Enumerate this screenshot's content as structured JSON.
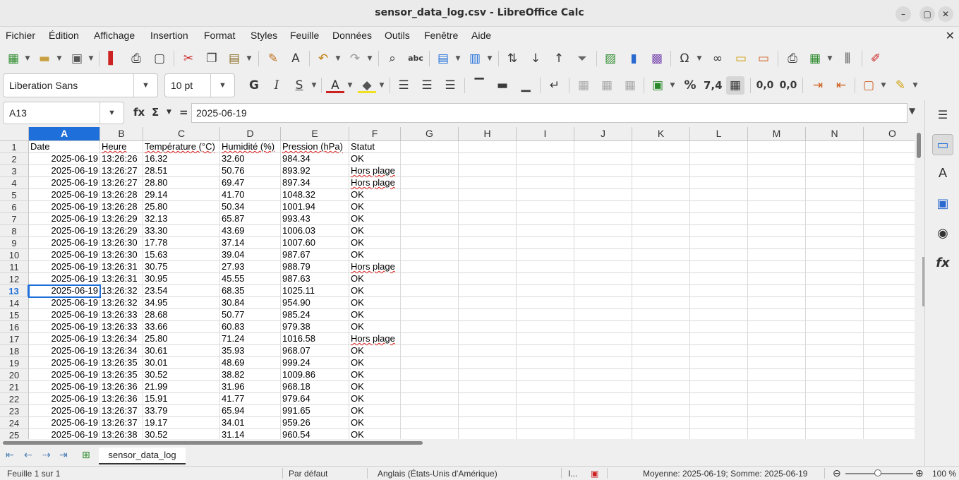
{
  "window": {
    "title": "sensor_data_log.csv - LibreOffice Calc",
    "minimize": "–",
    "maximize": "▢",
    "close": "✕"
  },
  "menu": [
    "Fichier",
    "Édition",
    "Affichage",
    "Insertion",
    "Format",
    "Styles",
    "Feuille",
    "Données",
    "Outils",
    "Fenêtre",
    "Aide"
  ],
  "menu_close": "✕",
  "toolbar2": {
    "font_name": "Liberation Sans",
    "font_size": "10 pt",
    "bold": "G",
    "italic": "I",
    "underline": "S",
    "percent": "%",
    "number": "7,4",
    "add_decimal": "0,0",
    "del_decimal": "0,0"
  },
  "formula": {
    "cell_ref": "A13",
    "fx": "fx",
    "sigma": "Σ",
    "equals": "=",
    "content": "2025-06-19"
  },
  "columns": [
    "A",
    "B",
    "C",
    "D",
    "E",
    "F",
    "G",
    "H",
    "I",
    "J",
    "K",
    "L",
    "M",
    "N",
    "O"
  ],
  "selected_column": "A",
  "selected_row": 13,
  "headers": [
    "Date",
    "Heure",
    "Température (°C)",
    "Humidité (%)",
    "Pression (hPa)",
    "Statut"
  ],
  "rows": [
    [
      "2025-06-19",
      "13:26:26",
      "16.32",
      "32.60",
      "984.34",
      "OK"
    ],
    [
      "2025-06-19",
      "13:26:27",
      "28.51",
      "50.76",
      "893.92",
      "Hors plage"
    ],
    [
      "2025-06-19",
      "13:26:27",
      "28.80",
      "69.47",
      "897.34",
      "Hors plage"
    ],
    [
      "2025-06-19",
      "13:26:28",
      "29.14",
      "41.70",
      "1048.32",
      "OK"
    ],
    [
      "2025-06-19",
      "13:26:28",
      "25.80",
      "50.34",
      "1001.94",
      "OK"
    ],
    [
      "2025-06-19",
      "13:26:29",
      "32.13",
      "65.87",
      "993.43",
      "OK"
    ],
    [
      "2025-06-19",
      "13:26:29",
      "33.30",
      "43.69",
      "1006.03",
      "OK"
    ],
    [
      "2025-06-19",
      "13:26:30",
      "17.78",
      "37.14",
      "1007.60",
      "OK"
    ],
    [
      "2025-06-19",
      "13:26:30",
      "15.63",
      "39.04",
      "987.67",
      "OK"
    ],
    [
      "2025-06-19",
      "13:26:31",
      "30.75",
      "27.93",
      "988.79",
      "Hors plage"
    ],
    [
      "2025-06-19",
      "13:26:31",
      "30.95",
      "45.55",
      "987.63",
      "OK"
    ],
    [
      "2025-06-19",
      "13:26:32",
      "23.54",
      "68.35",
      "1025.11",
      "OK"
    ],
    [
      "2025-06-19",
      "13:26:32",
      "34.95",
      "30.84",
      "954.90",
      "OK"
    ],
    [
      "2025-06-19",
      "13:26:33",
      "28.68",
      "50.77",
      "985.24",
      "OK"
    ],
    [
      "2025-06-19",
      "13:26:33",
      "33.66",
      "60.83",
      "979.38",
      "OK"
    ],
    [
      "2025-06-19",
      "13:26:34",
      "25.80",
      "71.24",
      "1016.58",
      "Hors plage"
    ],
    [
      "2025-06-19",
      "13:26:34",
      "30.61",
      "35.93",
      "968.07",
      "OK"
    ],
    [
      "2025-06-19",
      "13:26:35",
      "30.01",
      "48.69",
      "999.24",
      "OK"
    ],
    [
      "2025-06-19",
      "13:26:35",
      "30.52",
      "38.82",
      "1009.86",
      "OK"
    ],
    [
      "2025-06-19",
      "13:26:36",
      "21.99",
      "31.96",
      "968.18",
      "OK"
    ],
    [
      "2025-06-19",
      "13:26:36",
      "15.91",
      "41.77",
      "979.64",
      "OK"
    ],
    [
      "2025-06-19",
      "13:26:37",
      "33.79",
      "65.94",
      "991.65",
      "OK"
    ],
    [
      "2025-06-19",
      "13:26:37",
      "19.17",
      "34.01",
      "959.26",
      "OK"
    ],
    [
      "2025-06-19",
      "13:26:38",
      "30.52",
      "31.14",
      "960.54",
      "OK"
    ]
  ],
  "sheet_tab": "sensor_data_log",
  "status": {
    "sheet": "Feuille 1 sur 1",
    "style": "Par défaut",
    "language": "Anglais (États-Unis d'Amérique)",
    "selection_mode": "I...",
    "summary": "Moyenne: 2025-06-19; Somme: 2025-06-19",
    "zoom_minus": "⊖",
    "zoom_plus": "⊕",
    "zoom": "100 %"
  },
  "colors": {
    "accent": "#1e6fd9",
    "error_squiggle": "#dd2222"
  }
}
